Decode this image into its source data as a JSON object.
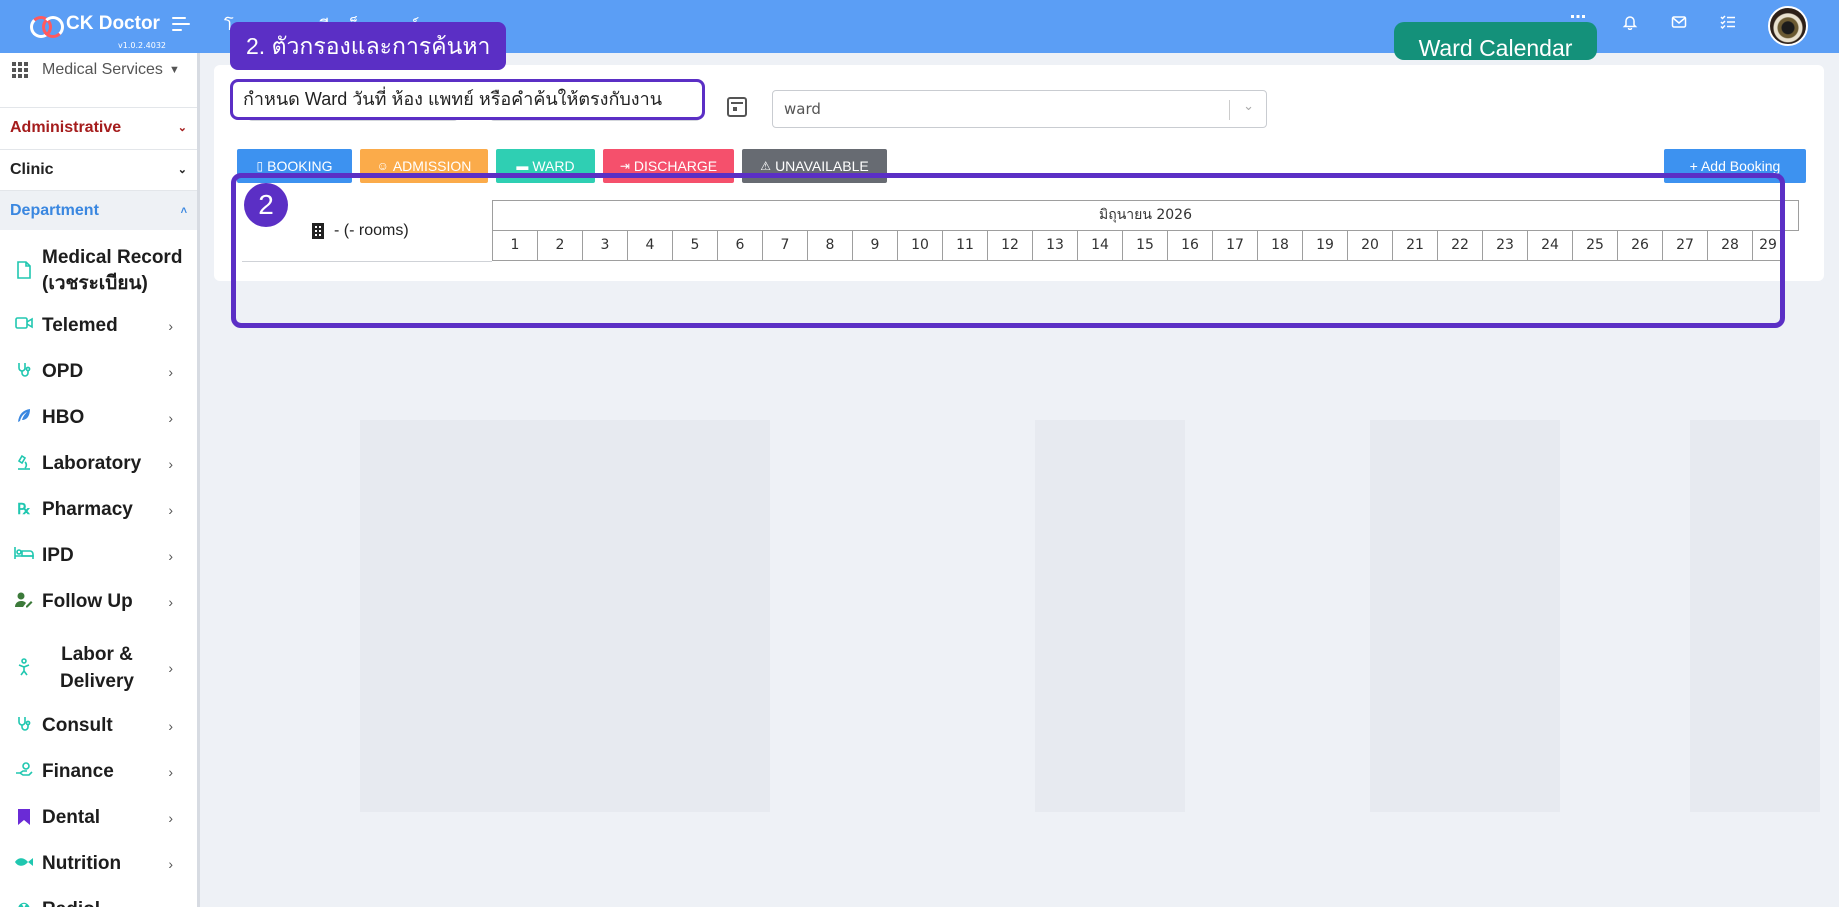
{
  "app": {
    "name": "CK Doctor",
    "version": "v1.0.2.4032",
    "hospital_name": "โรงพยาบาลซีเคด็อกเตอร์"
  },
  "header": {
    "icons": [
      "apps-icon",
      "bell-icon",
      "mail-icon",
      "tasks-icon"
    ]
  },
  "sidebar": {
    "service_selector": "Medical Services",
    "sections": {
      "administrative": "Administrative",
      "clinic": "Clinic",
      "department": "Department"
    },
    "items": [
      {
        "label": "Medical Record (เวชระเบียน)",
        "icon": "file-icon"
      },
      {
        "label": "Telemed",
        "icon": "video-icon"
      },
      {
        "label": "OPD",
        "icon": "stethoscope-icon"
      },
      {
        "label": "HBO",
        "icon": "feather-icon"
      },
      {
        "label": "Laboratory",
        "icon": "microscope-icon"
      },
      {
        "label": "Pharmacy",
        "icon": "prescription-icon"
      },
      {
        "label": "IPD",
        "icon": "bed-icon"
      },
      {
        "label": "Follow Up",
        "icon": "user-edit-icon"
      },
      {
        "label": "Labor & Delivery",
        "icon": "baby-icon"
      },
      {
        "label": "Consult",
        "icon": "stethoscope-icon"
      },
      {
        "label": "Finance",
        "icon": "hand-money-icon"
      },
      {
        "label": "Dental",
        "icon": "tooth-icon"
      },
      {
        "label": "Nutrition",
        "icon": "fish-icon"
      },
      {
        "label": "Radiol...",
        "icon": "radiology-icon"
      }
    ]
  },
  "filters": {
    "ward_select_value": "ward"
  },
  "status_buttons": {
    "booking": "BOOKING",
    "admission": "ADMISSION",
    "ward": "WARD",
    "discharge": "DISCHARGE",
    "unavailable": "UNAVAILABLE",
    "add_booking": "+ Add Booking"
  },
  "colors": {
    "booking": "#3d92f0",
    "admission": "#fbab4a",
    "ward": "#2fcfb3",
    "discharge": "#f5506c",
    "unavailable": "#676b72",
    "add_booking": "#3d92f0",
    "header": "#5b9ef5",
    "annotation": "#5b2fc5",
    "ward_calendar_label": "#14917a"
  },
  "calendar": {
    "room_label": "- (- rooms)",
    "month_label": "มิถุนายน 2026",
    "days": [
      "1",
      "2",
      "3",
      "4",
      "5",
      "6",
      "7",
      "8",
      "9",
      "10",
      "11",
      "12",
      "13",
      "14",
      "15",
      "16",
      "17",
      "18",
      "19",
      "20",
      "21",
      "22",
      "23",
      "24",
      "25",
      "26",
      "27",
      "28",
      "29"
    ]
  },
  "annotations": {
    "step_label": "2. ตัวกรองและการค้นหา",
    "step_description": "กำหนด Ward วันที่ ห้อง แพทย์ หรือคำค้นให้ตรงกับงาน",
    "step_number": "2",
    "ward_calendar_label": "Ward Calendar"
  }
}
